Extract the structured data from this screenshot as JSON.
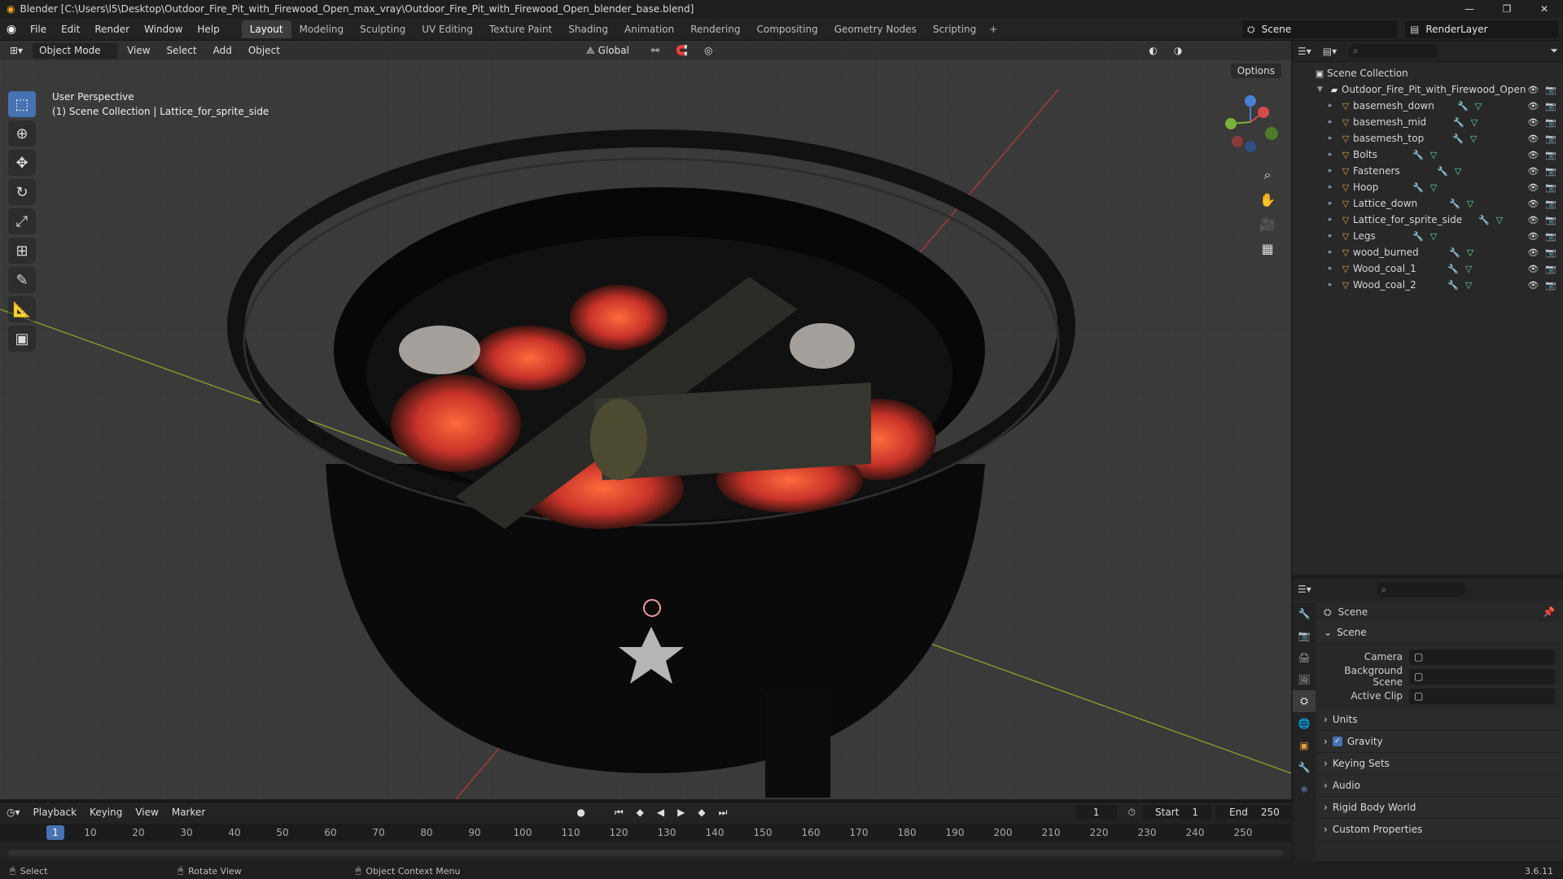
{
  "window": {
    "title": "Blender [C:\\Users\\l5\\Desktop\\Outdoor_Fire_Pit_with_Firewood_Open_max_vray\\Outdoor_Fire_Pit_with_Firewood_Open_blender_base.blend]"
  },
  "menu": [
    "File",
    "Edit",
    "Render",
    "Window",
    "Help"
  ],
  "workspaces": [
    "Layout",
    "Modeling",
    "Sculpting",
    "UV Editing",
    "Texture Paint",
    "Shading",
    "Animation",
    "Rendering",
    "Compositing",
    "Geometry Nodes",
    "Scripting"
  ],
  "scene_name": "Scene",
  "view_layer": "RenderLayer",
  "viewport": {
    "mode": "Object Mode",
    "menus": [
      "View",
      "Select",
      "Add",
      "Object"
    ],
    "transform": "Global",
    "options": "Options",
    "perspective": "User Perspective",
    "context": "(1) Scene Collection | Lattice_for_sprite_side"
  },
  "outliner": {
    "root": "Scene Collection",
    "collection": "Outdoor_Fire_Pit_with_Firewood_Open",
    "objects": [
      "basemesh_down",
      "basemesh_mid",
      "basemesh_top",
      "Bolts",
      "Fasteners",
      "Hoop",
      "Lattice_down",
      "Lattice_for_sprite_side",
      "Legs",
      "wood_burned",
      "Wood_coal_1",
      "Wood_coal_2"
    ]
  },
  "properties": {
    "header": "Scene",
    "panel": "Scene",
    "fields": [
      {
        "label": "Camera",
        "value": ""
      },
      {
        "label": "Background Scene",
        "value": ""
      },
      {
        "label": "Active Clip",
        "value": ""
      }
    ],
    "sections": [
      "Units",
      "Gravity",
      "Keying Sets",
      "Audio",
      "Rigid Body World",
      "Custom Properties"
    ]
  },
  "timeline": {
    "menus": [
      "Playback",
      "Keying",
      "View",
      "Marker"
    ],
    "current_frame": "1",
    "start_label": "Start",
    "start": "1",
    "end_label": "End",
    "end": "250",
    "ticks": [
      "10",
      "20",
      "30",
      "40",
      "50",
      "60",
      "70",
      "80",
      "90",
      "100",
      "110",
      "120",
      "130",
      "140",
      "150",
      "160",
      "170",
      "180",
      "190",
      "200",
      "210",
      "220",
      "230",
      "240",
      "250"
    ]
  },
  "status": {
    "select": "Select",
    "rotate": "Rotate View",
    "context_menu": "Object Context Menu",
    "version": "3.6.11"
  },
  "colors": {
    "accent": "#4772b3",
    "object_icon": "#e89c3a"
  }
}
